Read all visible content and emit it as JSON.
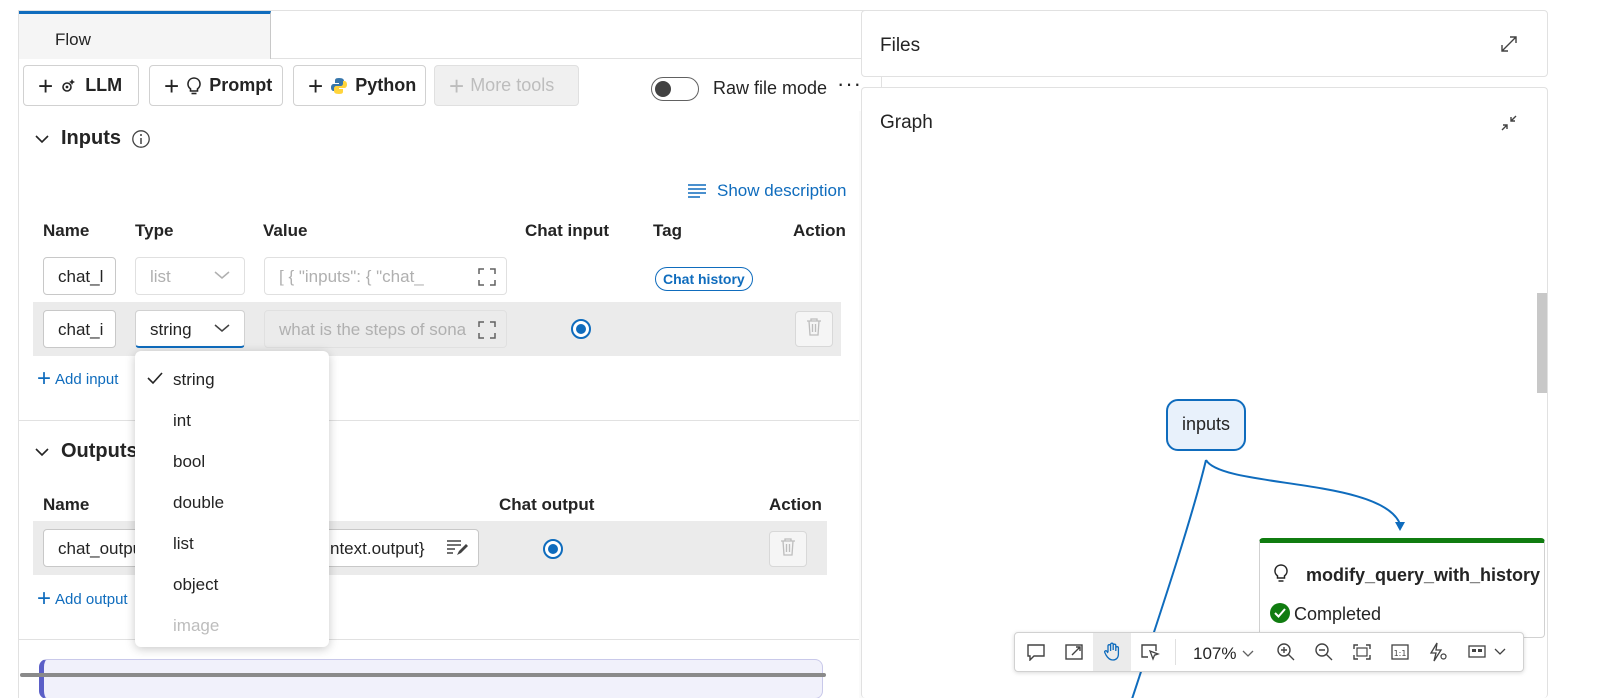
{
  "tabs": {
    "flow": "Flow"
  },
  "toolbar": {
    "llm": "LLM",
    "prompt": "Prompt",
    "python": "Python",
    "more_tools": "More tools",
    "raw_file_mode": "Raw file mode",
    "raw_file_mode_on": false,
    "more": "···"
  },
  "inputs": {
    "title": "Inputs",
    "show_description": "Show description",
    "headers": {
      "name": "Name",
      "type": "Type",
      "value": "Value",
      "chat_input": "Chat input",
      "tag": "Tag",
      "action": "Action"
    },
    "rows": [
      {
        "name": "chat_l",
        "type": "list",
        "value": "[ {   \"inputs\": {     \"chat_",
        "tag": "Chat history"
      },
      {
        "name": "chat_i",
        "type": "string",
        "value": "what is the steps of sona",
        "chat_input": true
      }
    ],
    "add": "Add input"
  },
  "outputs": {
    "title": "Outputs",
    "headers": {
      "name": "Name",
      "chat_output": "Chat output",
      "action": "Action"
    },
    "rows": [
      {
        "name": "chat_outpu",
        "value": "ntext.output}",
        "chat_output": true
      }
    ],
    "add": "Add output"
  },
  "type_dropdown": {
    "selected": "string",
    "options": [
      "string",
      "int",
      "bool",
      "double",
      "list",
      "object",
      "image"
    ],
    "disabled": [
      "image"
    ]
  },
  "files": {
    "title": "Files"
  },
  "graph": {
    "title": "Graph",
    "nodes": {
      "inputs": "inputs",
      "modify_title": "modify_query_with_history",
      "modify_status": "Completed"
    },
    "zoom": "107%"
  },
  "colors": {
    "accent": "#0f6cbd",
    "success": "#107c10"
  }
}
